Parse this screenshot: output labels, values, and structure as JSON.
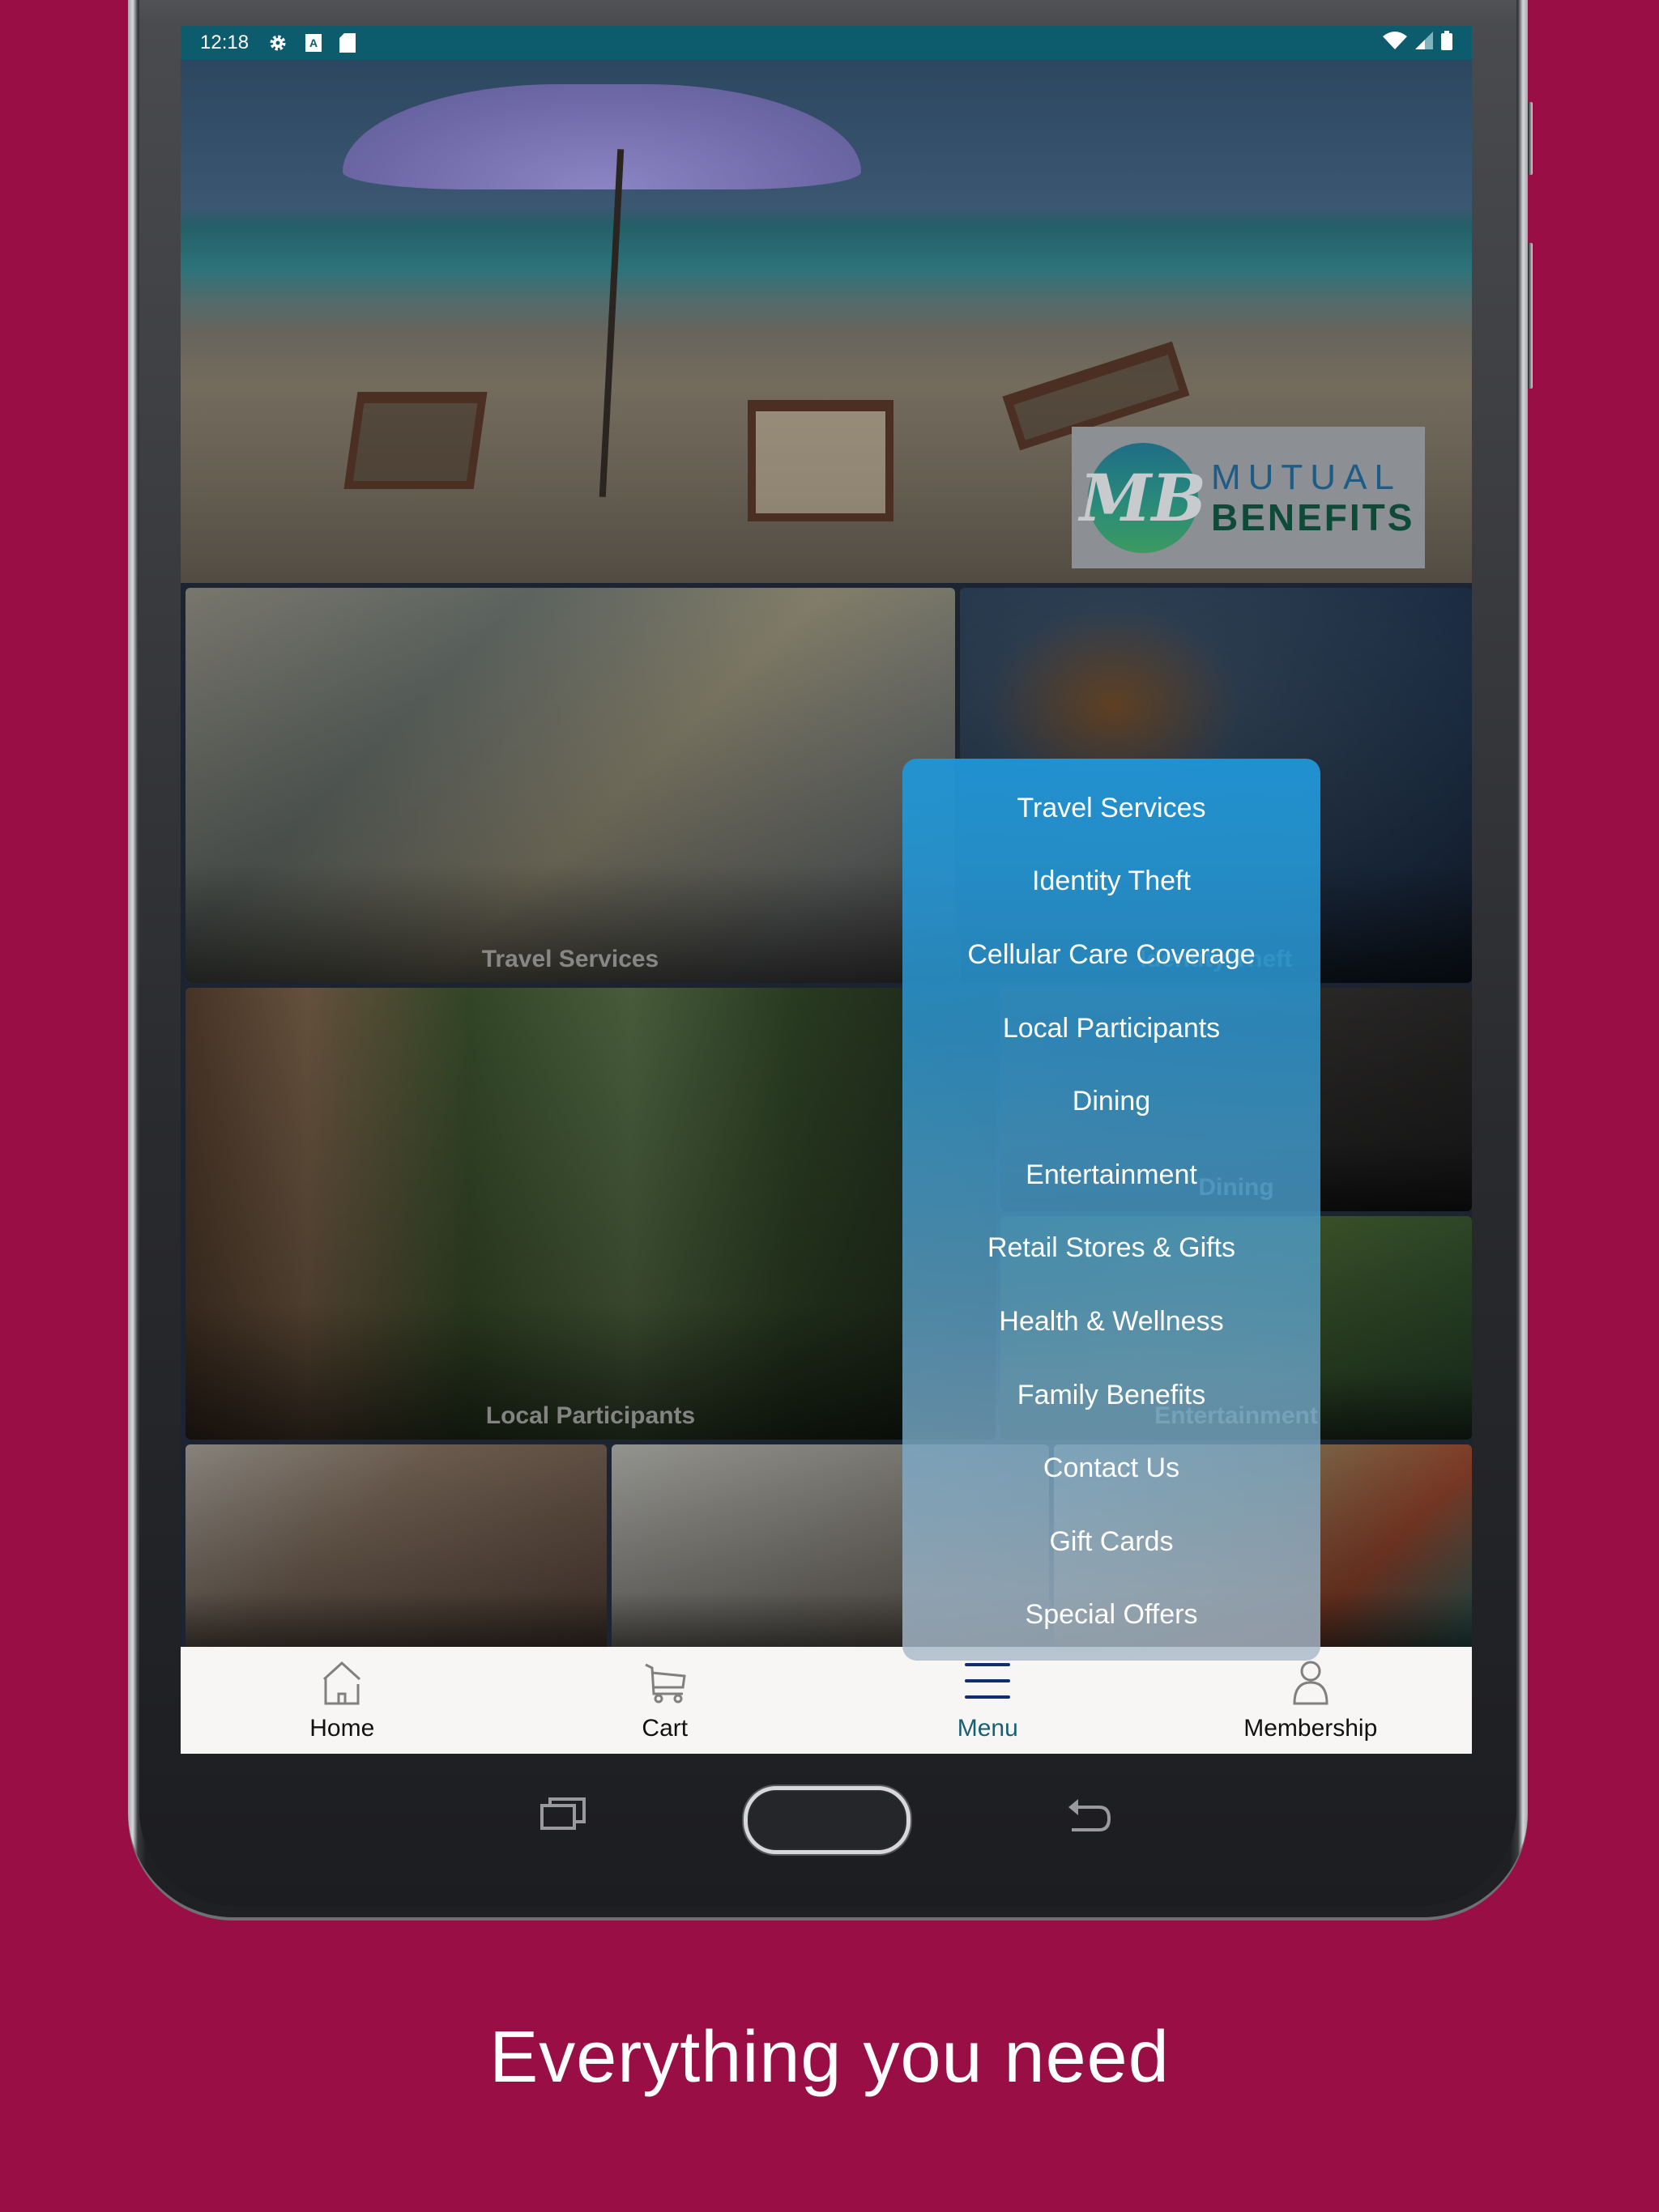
{
  "statusbar": {
    "time": "12:18",
    "left_icons": [
      "settings-gear-icon",
      "font-a-icon",
      "sd-card-icon"
    ],
    "right_icons": [
      "wifi-icon",
      "cell-signal-icon",
      "battery-icon"
    ]
  },
  "hero": {
    "logo": {
      "monogram": "MB",
      "line1": "MUTUAL",
      "line2": "BENEFITS"
    }
  },
  "tiles": [
    {
      "label": "Travel Services"
    },
    {
      "label": "Identity Theft"
    },
    {
      "label": "Local Participants"
    },
    {
      "label": "Dining"
    },
    {
      "label": "Entertainment"
    },
    {
      "label": ""
    },
    {
      "label": ""
    },
    {
      "label": ""
    }
  ],
  "menu": {
    "items": [
      {
        "label": "Travel Services"
      },
      {
        "label": "Identity Theft"
      },
      {
        "label": "Cellular Care Coverage"
      },
      {
        "label": "Local Participants"
      },
      {
        "label": "Dining"
      },
      {
        "label": "Entertainment"
      },
      {
        "label": "Retail Stores & Gifts"
      },
      {
        "label": "Health & Wellness"
      },
      {
        "label": "Family Benefits"
      },
      {
        "label": "Contact Us"
      },
      {
        "label": "Gift Cards"
      },
      {
        "label": "Special Offers"
      }
    ]
  },
  "bottom_nav": {
    "active": "Menu",
    "items": [
      {
        "label": "Home",
        "icon": "home-icon"
      },
      {
        "label": "Cart",
        "icon": "cart-icon"
      },
      {
        "label": "Menu",
        "icon": "hamburger-menu-icon"
      },
      {
        "label": "Membership",
        "icon": "person-icon"
      }
    ]
  },
  "colors": {
    "background": "#990f45",
    "statusbar": "#0d5c6e",
    "menu_panel": "#2096d7",
    "nav_active_icon": "#0f2e6e",
    "nav_active_label": "#17606f"
  },
  "caption": "Everything you need"
}
